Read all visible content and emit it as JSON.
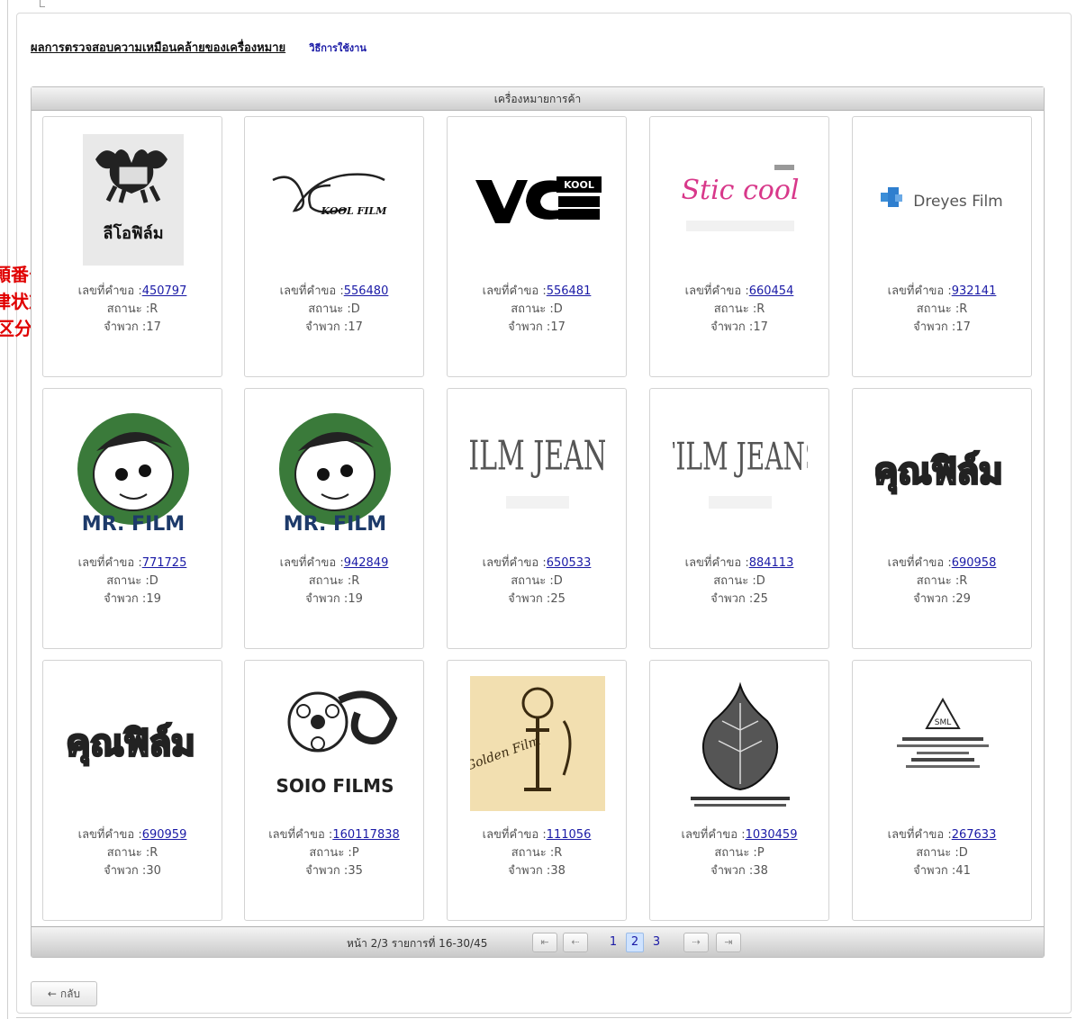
{
  "header": {
    "title": "ผลการตรวจสอบความเหมือนคล้ายของเครื่องหมาย",
    "help": "วิธีการใช้งาน"
  },
  "side_notes": [
    "願番号",
    "律状態",
    "区分"
  ],
  "grid": {
    "heading": "เครื่องหมายการค้า"
  },
  "labels": {
    "req_no": "เลขที่คำขอ :",
    "status": "สถานะ :",
    "class": "จำพวก :"
  },
  "cards": [
    {
      "req_no": "450797",
      "status": "R",
      "class": "17",
      "logo_text": "ลีโอฟิล์ม"
    },
    {
      "req_no": "556480",
      "status": "D",
      "class": "17",
      "logo_text": "KOOL FILM"
    },
    {
      "req_no": "556481",
      "status": "D",
      "class": "17",
      "logo_text": "KOOL"
    },
    {
      "req_no": "660454",
      "status": "R",
      "class": "17",
      "logo_text": "Stic cool"
    },
    {
      "req_no": "932141",
      "status": "R",
      "class": "17",
      "logo_text": "Dreyes Film"
    },
    {
      "req_no": "771725",
      "status": "D",
      "class": "19",
      "logo_text": "MR. FILM"
    },
    {
      "req_no": "942849",
      "status": "R",
      "class": "19",
      "logo_text": "MR. FILM"
    },
    {
      "req_no": "650533",
      "status": "D",
      "class": "25",
      "logo_text": "FILM JEANS"
    },
    {
      "req_no": "884113",
      "status": "D",
      "class": "25",
      "logo_text": "FILM JEANS"
    },
    {
      "req_no": "690958",
      "status": "R",
      "class": "29",
      "logo_text": "คุณฟิล์ม"
    },
    {
      "req_no": "690959",
      "status": "R",
      "class": "30",
      "logo_text": "คุณฟิล์ม"
    },
    {
      "req_no": "160117838",
      "status": "P",
      "class": "35",
      "logo_text": "SOIO FILMS"
    },
    {
      "req_no": "111056",
      "status": "R",
      "class": "38",
      "logo_text": "Golden Film"
    },
    {
      "req_no": "1030459",
      "status": "P",
      "class": "38",
      "logo_text": ""
    },
    {
      "req_no": "267633",
      "status": "D",
      "class": "41",
      "logo_text": "SML"
    }
  ],
  "pager": {
    "info": "หน้า 2/3 รายการที่ 16-30/45",
    "pages": [
      "1",
      "2",
      "3"
    ],
    "current": "2"
  },
  "back_label": "กลับ"
}
